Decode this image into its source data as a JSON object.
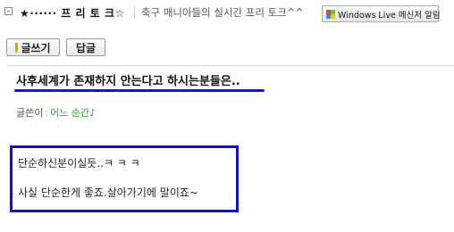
{
  "board": {
    "title": "★······ 프 리 토 크☆",
    "subtitle": "축구 매니아들의 실시간 프리 토크^^",
    "wl_button_label": "Windows Live 메신저 알림"
  },
  "toolbar": {
    "write_label": "글쓰기",
    "reply_label": "답글"
  },
  "post": {
    "title": "사후세계가 존재하지 안는다고 하시는분들은..",
    "author_label": "글쓴이",
    "author_sep": ":",
    "author_name": "어느 순간♪",
    "lines": [
      "단순하신분이실듯..ㅋ ㅋ ㅋ",
      "사실 단순한게 좋죠.살아가기에 말이죠~"
    ]
  },
  "colors": {
    "highlight_blue": "#0c0ce0",
    "author_green": "#3a9a3a"
  }
}
